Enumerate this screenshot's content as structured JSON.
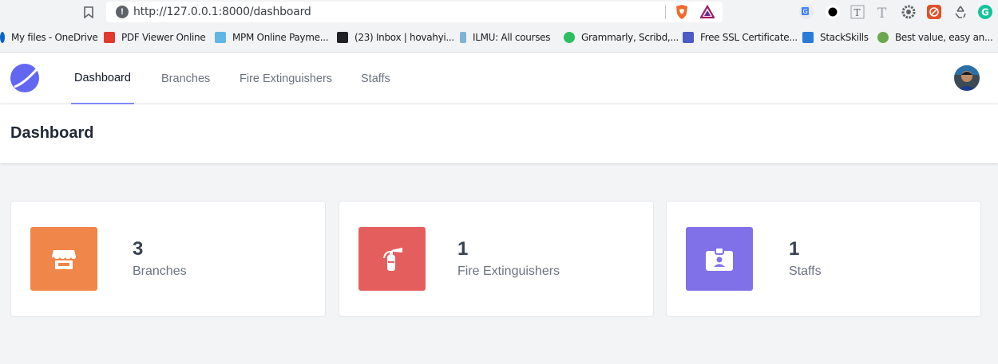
{
  "browser": {
    "url": "http://127.0.0.1:8000/dashboard",
    "bookmarks": [
      {
        "label": "My files - OneDrive",
        "icon": "onedrive-icon"
      },
      {
        "label": "PDF Viewer Online",
        "icon": "pdf-icon"
      },
      {
        "label": "MPM Online Payme...",
        "icon": "mpm-icon"
      },
      {
        "label": "(23) Inbox | hovahyi...",
        "icon": "inbox-icon"
      },
      {
        "label": "ILMU: All courses",
        "icon": "ilmu-icon"
      },
      {
        "label": "Grammarly, Scribd,...",
        "icon": "evernote-icon"
      },
      {
        "label": "Free SSL Certificate...",
        "icon": "puzzle-icon"
      },
      {
        "label": "StackSkills",
        "icon": "stackskills-icon"
      },
      {
        "label": "Best value, easy an...",
        "icon": "leaf-icon"
      }
    ],
    "extensions": [
      "translate-icon",
      "record-icon",
      "text-t-icon",
      "text-t-large-icon",
      "gear-icon",
      "block-icon",
      "recycle-icon",
      "grammarly-icon"
    ]
  },
  "nav": {
    "items": [
      {
        "label": "Dashboard",
        "active": true
      },
      {
        "label": "Branches",
        "active": false
      },
      {
        "label": "Fire Extinguishers",
        "active": false
      },
      {
        "label": "Staffs",
        "active": false
      }
    ]
  },
  "header": {
    "title": "Dashboard"
  },
  "stats": [
    {
      "count": "3",
      "label": "Branches",
      "color": "#f0864a",
      "icon": "store-icon"
    },
    {
      "count": "1",
      "label": "Fire Extinguishers",
      "color": "#e45e5e",
      "icon": "fire-extinguisher-icon"
    },
    {
      "count": "1",
      "label": "Staffs",
      "color": "#8071e8",
      "icon": "id-badge-icon"
    }
  ]
}
